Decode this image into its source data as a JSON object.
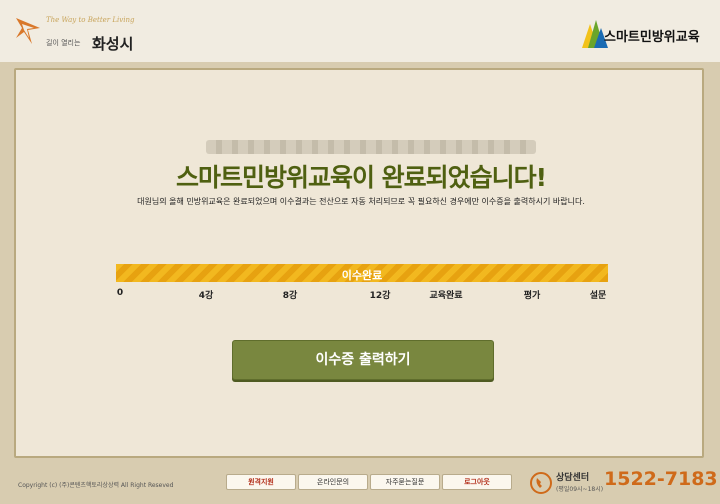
{
  "header": {
    "tagline": "The Way to Better Living",
    "slogan": "길이 열리는",
    "city": "화성시",
    "brand": "스마트민방위교육"
  },
  "main": {
    "user_name": "",
    "headline": "스마트민방위교육이 완료되었습니다!",
    "description": "대원님의 올해 민방위교육은 완료되었으며 이수결과는 전산으로 자동 처리되므로 꼭 필요하신 경우에만 이수증을 출력하시기 바랍니다.",
    "progress_label": "이수완료",
    "progress_value": 1.0,
    "steps": [
      "0",
      "4강",
      "8강",
      "12강",
      "교육완료",
      "평가",
      "설문"
    ],
    "print_button": "이수증 출력하기"
  },
  "footer": {
    "copyright": "Copyright (c) (주)콘텐츠핵토리상상력 All Right Reseved",
    "buttons": [
      "원격지원",
      "온라인문의",
      "자주묻는질문",
      "로그아웃"
    ],
    "center_label": "상담센터",
    "center_hours": "(평일09시~18시)",
    "phone": "1522-7183"
  },
  "colors": {
    "headline": "#4f6011",
    "progress": "#f2b81f",
    "button": "#79873f",
    "phone": "#cf6a1a"
  }
}
